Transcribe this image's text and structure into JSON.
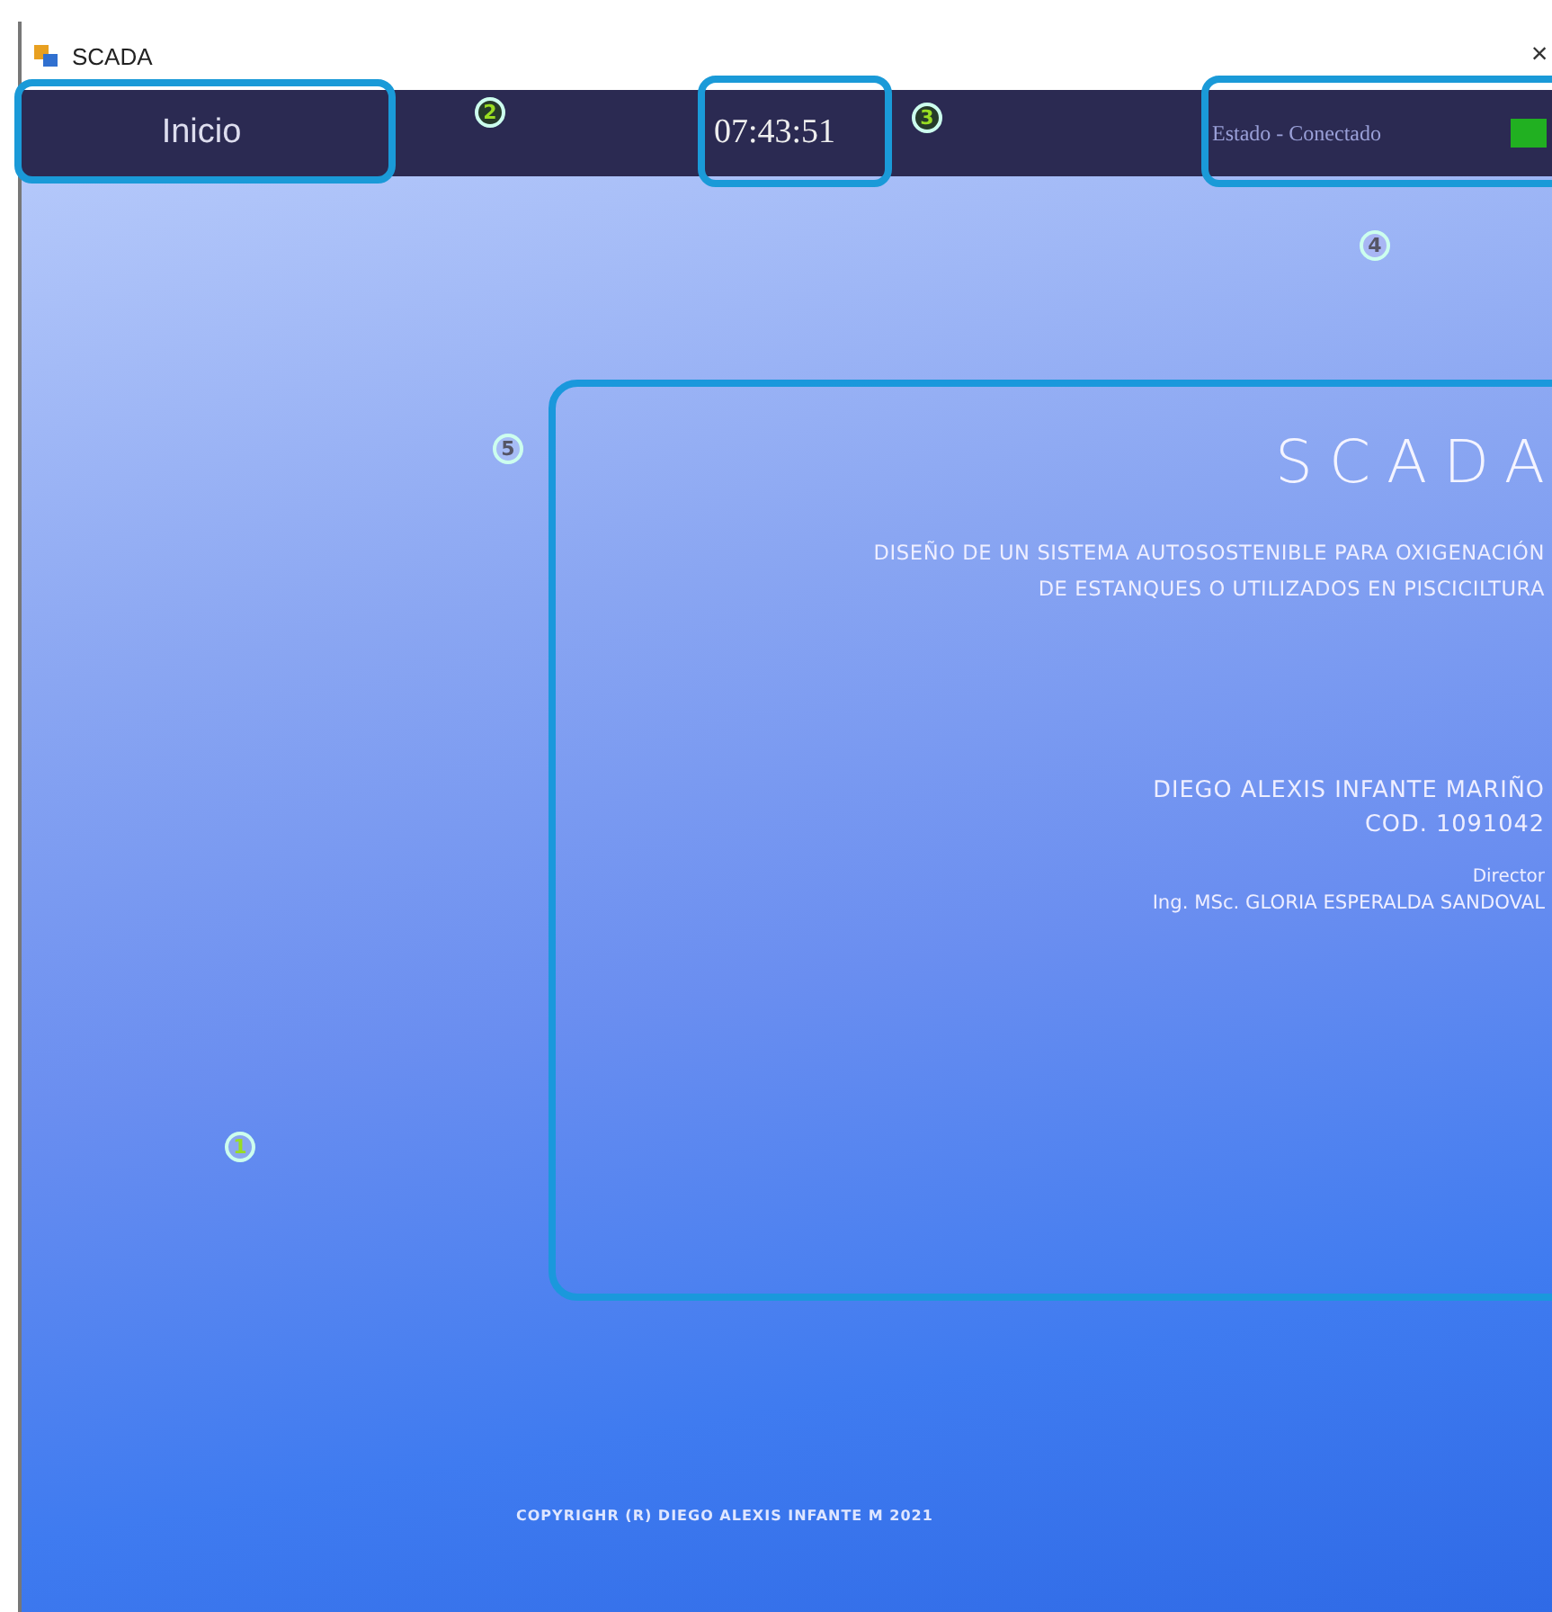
{
  "window": {
    "title": "SCADA",
    "close": "×"
  },
  "nav": {
    "home": "Inicio",
    "clock": "07:43:51",
    "status": "Estado - Conectado",
    "connected": true
  },
  "card": {
    "title": "SCADA",
    "subtitle_lines": [
      "DISEÑO DE UN SISTEMA AUTOSOSTENIBLE PARA OXIGENACIÓN",
      "DE ESTANQUES O UTILIZADOS EN PISCICILTURA"
    ],
    "author": "DIEGO ALEXIS INFANTE MARIÑO",
    "code": "COD. 1091042",
    "director_label": "Director",
    "director": "Ing. MSc. GLORIA ESPERALDA SANDOVAL"
  },
  "footer": "COPYRIGHR (R) DIEGO ALEXIS INFANTE M 2021",
  "callouts": [
    "1",
    "2",
    "3",
    "4",
    "5"
  ]
}
